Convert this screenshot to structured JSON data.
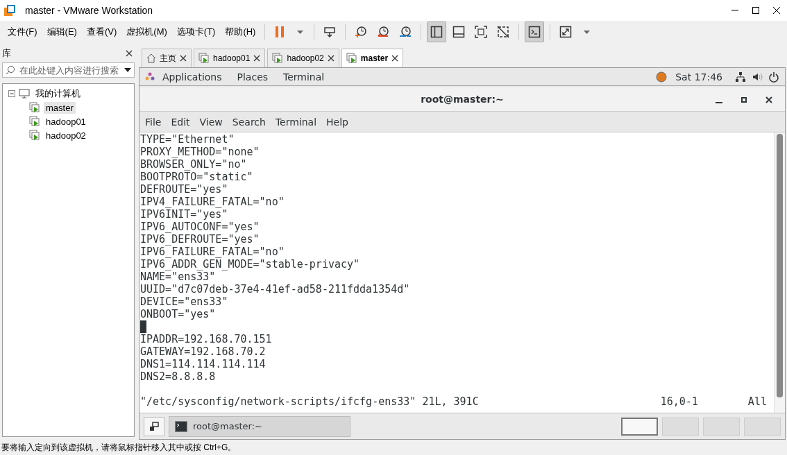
{
  "window": {
    "title": "master - VMware Workstation"
  },
  "menu": [
    "文件(F)",
    "编辑(E)",
    "查看(V)",
    "虚拟机(M)",
    "选项卡(T)",
    "帮助(H)"
  ],
  "toolbar": [
    [
      {
        "kind": "pause",
        "selected": false
      },
      {
        "kind": "caret",
        "selected": false
      }
    ],
    [
      {
        "kind": "send-keys",
        "selected": false
      }
    ],
    [
      {
        "kind": "snapshot-take",
        "selected": false
      },
      {
        "kind": "snapshot-revert",
        "selected": false
      },
      {
        "kind": "snapshot-manage",
        "selected": false
      }
    ],
    [
      {
        "kind": "view-library",
        "selected": true
      },
      {
        "kind": "view-thumb",
        "selected": false
      },
      {
        "kind": "view-full",
        "selected": false
      },
      {
        "kind": "view-unity",
        "selected": false
      }
    ],
    [
      {
        "kind": "console",
        "selected": true
      }
    ],
    [
      {
        "kind": "stretch",
        "selected": false
      },
      {
        "kind": "caret",
        "selected": false
      }
    ]
  ],
  "library": {
    "title": "库",
    "search": {
      "placeholder": "在此处键入内容进行搜索"
    },
    "tree": [
      {
        "label": "我的计算机",
        "expanded": true,
        "children": [
          {
            "label": "master",
            "selected": true
          },
          {
            "label": "hadoop01",
            "selected": false
          },
          {
            "label": "hadoop02",
            "selected": false
          }
        ]
      }
    ]
  },
  "tabs": [
    {
      "kind": "home",
      "label": "主页",
      "selected": false
    },
    {
      "kind": "vm",
      "label": "hadoop01",
      "selected": false
    },
    {
      "kind": "vm",
      "label": "hadoop02",
      "selected": false
    },
    {
      "kind": "vm",
      "label": "master",
      "selected": true
    }
  ],
  "guest": {
    "top_bar": {
      "menus": [
        "Applications",
        "Places",
        "Terminal"
      ],
      "clock": "Sat 17:46"
    },
    "terminal": {
      "title": "root@master:~",
      "menu": [
        "File",
        "Edit",
        "View",
        "Search",
        "Terminal",
        "Help"
      ],
      "lines": [
        {
          "kind": "text",
          "text": "TYPE=\"Ethernet\""
        },
        {
          "kind": "text",
          "text": "PROXY_METHOD=\"none\""
        },
        {
          "kind": "text",
          "text": "BROWSER_ONLY=\"no\""
        },
        {
          "kind": "text",
          "text": "BOOTPROTO=\"static\""
        },
        {
          "kind": "text",
          "text": "DEFROUTE=\"yes\""
        },
        {
          "kind": "text",
          "text": "IPV4_FAILURE_FATAL=\"no\""
        },
        {
          "kind": "text",
          "text": "IPV6INIT=\"yes\""
        },
        {
          "kind": "text",
          "text": "IPV6_AUTOCONF=\"yes\""
        },
        {
          "kind": "text",
          "text": "IPV6_DEFROUTE=\"yes\""
        },
        {
          "kind": "text",
          "text": "IPV6_FAILURE_FATAL=\"no\""
        },
        {
          "kind": "text",
          "text": "IPV6_ADDR_GEN_MODE=\"stable-privacy\""
        },
        {
          "kind": "text",
          "text": "NAME=\"ens33\""
        },
        {
          "kind": "text",
          "text": "UUID=\"d7c07deb-37e4-41ef-ad58-211fdda1354d\""
        },
        {
          "kind": "text",
          "text": "DEVICE=\"ens33\""
        },
        {
          "kind": "text",
          "text": "ONBOOT=\"yes\""
        },
        {
          "kind": "cursor"
        },
        {
          "kind": "text",
          "text": "IPADDR=192.168.70.151"
        },
        {
          "kind": "text",
          "text": "GATEWAY=192.168.70.2"
        },
        {
          "kind": "text",
          "text": "DNS1=114.114.114.114"
        },
        {
          "kind": "text",
          "text": "DNS2=8.8.8.8"
        },
        {
          "kind": "blank"
        }
      ],
      "status": {
        "file": "\"/etc/sysconfig/network-scripts/ifcfg-ens33\" 21L, 391C",
        "position": "16,0-1",
        "scroll": "All"
      }
    },
    "taskbar": {
      "window": "root@master:~",
      "workspaces": [
        {
          "selected": true
        },
        {
          "selected": false
        },
        {
          "selected": false
        },
        {
          "selected": false
        }
      ]
    }
  },
  "status_bar": "要将输入定向到该虚拟机，请将鼠标指针移入其中或按 Ctrl+G。"
}
